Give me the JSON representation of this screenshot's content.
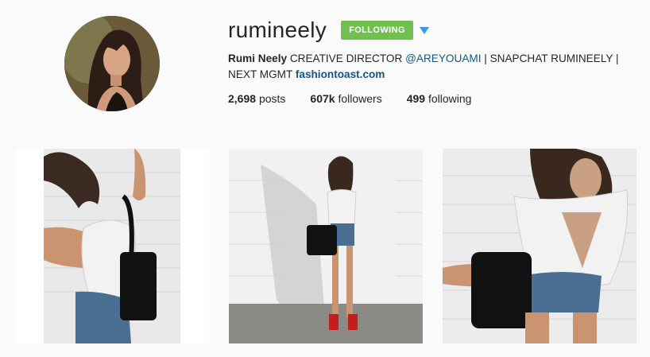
{
  "profile": {
    "username": "rumineely",
    "follow_button_label": "FOLLOWING",
    "bio": {
      "name": "Rumi Neely",
      "text1": "CREATIVE DIRECTOR",
      "mention": "@AREYOUAMI",
      "text2": "| SNAPCHAT RUMINEELY | NEXT MGMT",
      "website": "fashiontoast.com"
    },
    "stats": {
      "posts_count": "2,698",
      "posts_label": "posts",
      "followers_count": "607k",
      "followers_label": "followers",
      "following_count": "499",
      "following_label": "following"
    }
  },
  "colors": {
    "follow_green": "#70c050",
    "caret_blue": "#3897f0",
    "link_blue": "#125688"
  },
  "icons": {
    "dropdown": "caret-down-icon"
  }
}
